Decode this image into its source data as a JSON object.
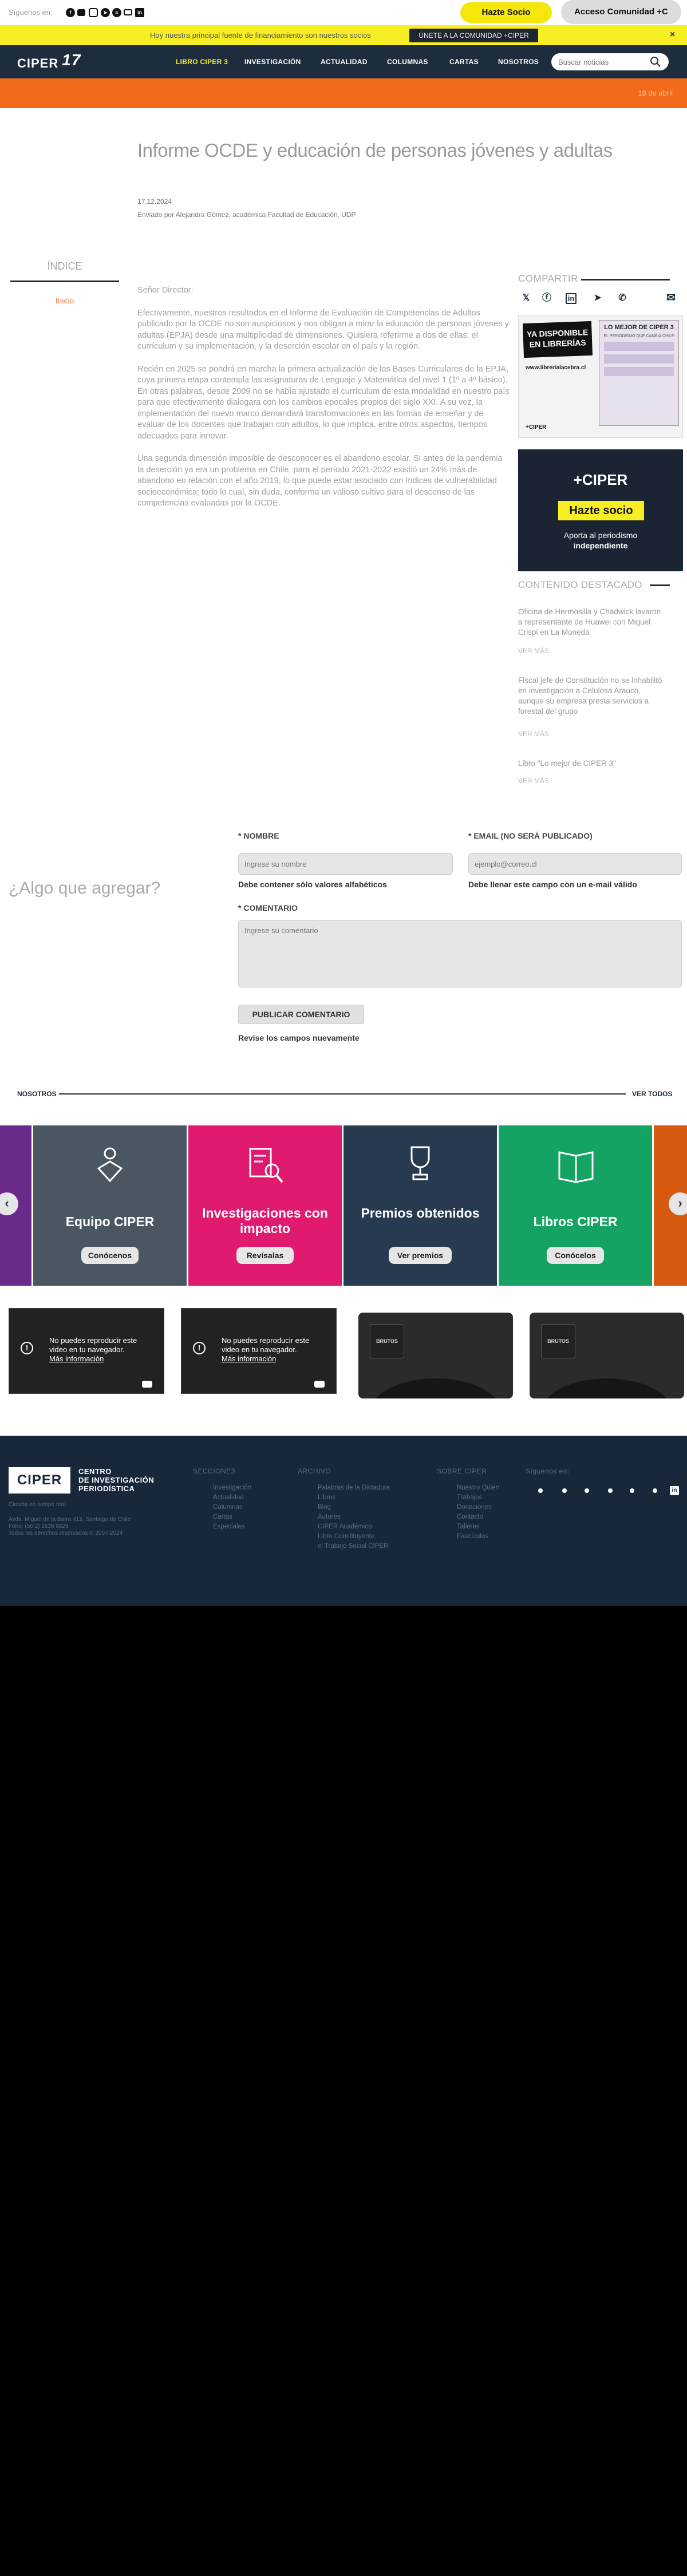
{
  "topbar": {
    "follow_label": "Síguenos en:",
    "hazte_socio": "Hazte Socio",
    "acceso": "Acceso Comunidad +C"
  },
  "announcement": {
    "text": "Hoy nuestra principal fuente de financiamiento son nuestros socios",
    "button": "ÚNETE A LA COMUNIDAD +CIPER",
    "close": "×"
  },
  "nav": {
    "logo": "CIPER",
    "logo_number": "17",
    "items": [
      "LIBRO CIPER 3",
      "INVESTIGACIÓN",
      "ACTUALIDAD",
      "COLUMNAS",
      "CARTAS",
      "NOSOTROS"
    ],
    "search_placeholder": "Buscar noticias",
    "active_color": "#f7ee23"
  },
  "orange_bar": {
    "text": "18 de abril"
  },
  "article": {
    "title": "Informe OCDE y educación de personas jóvenes y adultas",
    "date": "17.12.2024",
    "author": "Enviado por Alejandra Gómez, académica Facultad de Educación, UDP",
    "salutation": "Señor Director:",
    "paragraphs": [
      "Efectivamente, nuestros resultados en el Informe de Evaluación de Competencias de Adultos publicado por la OCDE no son auspiciosos y nos obligan a mirar la educación de personas jóvenes y adultas (EPJA) desde una multiplicidad de dimensiones. Quisiera referirme a dos de ellas: el currículum y su implementación, y la deserción escolar en el país y la región.",
      "Recién en 2025 se pondrá en marcha la primera actualización de las Bases Curriculares de la EPJA, cuya primera etapa contempla las asignaturas de Lenguaje y Matemática del nivel 1 (1º a 4º básico). En otras palabras, desde 2009 no se había ajustado el currículum de esta modalidad en nuestro país para que efectivamente dialogara con los cambios epocales propios del siglo XXI. A su vez, la implementación del nuevo marco demandará transformaciones en las formas de enseñar y de evaluar de los docentes que trabajan con adultos, lo que implica, entre otros aspectos, tiempos adecuados para innovar.",
      "Una segunda dimensión imposible de desconocer es el abandono escolar. Si antes de la pandemia la deserción ya era un problema en Chile, para el período 2021-2022 existió un 24% más de abandono en relación con el año 2019, lo que puede estar asociado con índices de vulnerabilidad socioeconómica; todo lo cual, sin duda, conforma un valioso cultivo para el descenso de las competencias evaluadas por la OCDE."
    ]
  },
  "indice": {
    "heading": "ÍNDICE",
    "item": "Inicio"
  },
  "sidebar": {
    "share_heading": "COMPARTIR",
    "share_icons": [
      "x-icon",
      "facebook-icon",
      "linkedin-icon",
      "telegram-icon",
      "whatsapp-icon",
      "email-icon"
    ],
    "book_ad": {
      "badge_line1": "YA DISPONIBLE",
      "badge_line2": "EN LIBRERÍAS",
      "url": "www.librerialacebra.cl",
      "headline": "LO MEJOR DE CIPER 3",
      "subtitle": "EL PERIODISMO QUE CAMBIA CHILE",
      "brand": "+CIPER"
    },
    "socio_ad": {
      "brand": "+CIPER",
      "button": "Hazte socio",
      "line1": "Aporta al periodismo",
      "line2": "independiente"
    },
    "destacado_heading": "CONTENIDO DESTACADO",
    "destacado": [
      {
        "title": "Oficina de Hermosilla y Chadwick lavaron a representante de Huawei con Miguel Crispi en La Moneda",
        "more": "VER MÁS"
      },
      {
        "title": "Fiscal jefe de Constitución no se inhabilitó en investigación a Celulosa Arauco, aunque su empresa presta servicios a forestal del grupo",
        "more": "VER MÁS"
      },
      {
        "title": "Libro \"Lo mejor de CIPER 3\"",
        "more": "VER MÁS"
      }
    ]
  },
  "comments": {
    "heading": "¿Algo que agregar?",
    "nombre_label": "* NOMBRE",
    "nombre_placeholder": "Ingrese su nombre",
    "nombre_error": "Debe contener sólo valores alfabéticos",
    "email_label": "* EMAIL (NO SERÁ PUBLICADO)",
    "email_placeholder": "ejemplo@correo.cl",
    "email_error": "Debe llenar este campo con un e-mail válido",
    "comentario_label": "* COMENTARIO",
    "comentario_placeholder": "Ingrese su comentario",
    "submit": "PUBLICAR COMENTARIO",
    "review": "Revise los campos nuevamente"
  },
  "nosotros": {
    "label": "NOSOTROS",
    "ver_todos": "VER TODOS",
    "tiles": [
      {
        "title": "Equipo CIPER",
        "button": "Conócenos",
        "color": "#4b5663"
      },
      {
        "title": "Investigaciones con impacto",
        "button": "Revísalas",
        "color": "#e01a6f"
      },
      {
        "title": "Premios obtenidos",
        "button": "Ver premios",
        "color": "#273a50"
      },
      {
        "title": "Libros CIPER",
        "button": "Conócelos",
        "color": "#14a362"
      }
    ],
    "prev": "‹",
    "next": "›"
  },
  "videos": {
    "error_line1": "No puedes reproducir este",
    "error_line2": "video en tu navegador.",
    "more_info": "Más información",
    "thumb_label": "BRUTOS"
  },
  "footer": {
    "logo": "CIPER",
    "logo_text_1": "CENTRO",
    "logo_text_2": "DE INVESTIGACIÓN",
    "logo_text_3": "PERIODÍSTICA",
    "tagline": "Ciencia en tiempo real",
    "address": "Avda. Miguel de la Barra 412, Santiago de Chile",
    "phone": "Fono: (56 2) 2638 9629",
    "rights": "Todos los derechos reservados © 2007-2024",
    "columns": [
      {
        "heading": "SECCIONES",
        "links": [
          "Investigación",
          "Actualidad",
          "Columnas",
          "Cartas",
          "Especiales"
        ]
      },
      {
        "heading": "ARCHIVO",
        "links": [
          "Palabras de la Dictadura",
          "Libros",
          "Blog",
          "Autores",
          "CIPER Académico",
          "Libro Constituyente",
          "el Trabajo Social CIPER"
        ]
      },
      {
        "heading": "SOBRE CIPER",
        "links": [
          "Nuestro Quien",
          "Trabajos",
          "Donaciones",
          "Contacto",
          "Talleres",
          "Fascículos"
        ]
      }
    ],
    "follow": "Síguenos en:"
  }
}
